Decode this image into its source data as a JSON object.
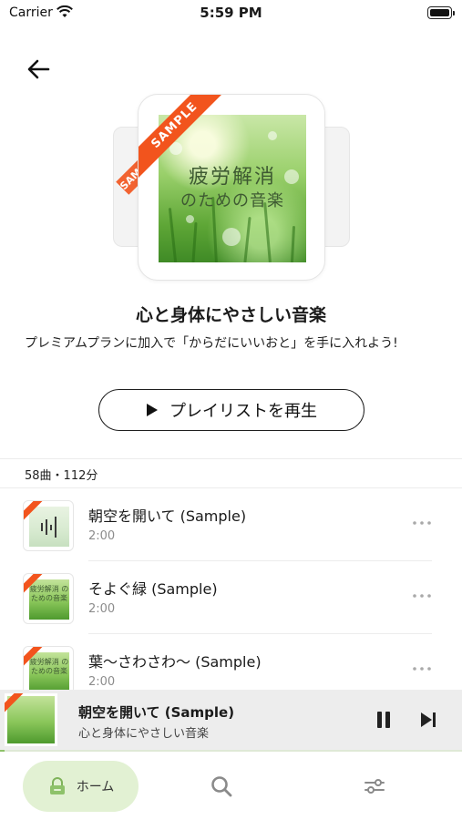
{
  "status_bar": {
    "carrier": "Carrier",
    "time": "5:59 PM"
  },
  "playlist": {
    "cover_title": "疲労解消",
    "cover_subtitle": "のための音楽",
    "badge": "SAMPLE",
    "title": "心と身体にやさしい音楽",
    "description": "プレミアムプランに加入で「からだにいいおと」を手に入れよう!",
    "play_label": "プレイリストを再生",
    "summary": "58曲・112分"
  },
  "tracks": [
    {
      "name": "朝空を開いて (Sample)",
      "duration": "2:00",
      "thumb": "waveform"
    },
    {
      "name": "そよぐ緑 (Sample)",
      "duration": "2:00",
      "thumb": "cover",
      "thumb_text": "疲労解消 のための音楽"
    },
    {
      "name": "葉～さわさわ～ (Sample)",
      "duration": "2:00",
      "thumb": "cover",
      "thumb_text": "疲労解消 のための音楽"
    }
  ],
  "now_playing": {
    "title": "朝空を開いて (Sample)",
    "subtitle": "心と身体にやさしい音楽",
    "progress": 0.01
  },
  "tab_bar": {
    "home_label": "ホーム"
  },
  "colors": {
    "accent_green": "#8ec26a",
    "home_pill": "#e2f1d3",
    "sample_badge": "#f2541d"
  },
  "icons": [
    "back-arrow-icon",
    "play-icon",
    "more-icon",
    "pause-icon",
    "skip-next-icon",
    "home-icon",
    "search-icon",
    "settings-sliders-icon",
    "wifi-icon",
    "battery-icon"
  ]
}
